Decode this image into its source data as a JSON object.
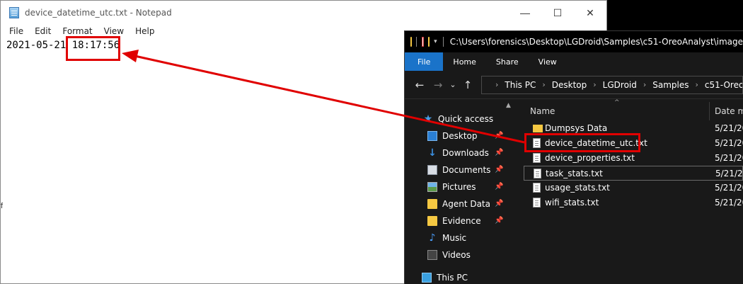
{
  "notepad": {
    "title": "device_datetime_utc.txt - Notepad",
    "controls": {
      "minimize": "—",
      "maximize": "☐",
      "close": "✕"
    },
    "menu": [
      "File",
      "Edit",
      "Format",
      "View",
      "Help"
    ],
    "content_date": "2021-05-21 ",
    "content_time": "18:17:56",
    "left_glyph": "f"
  },
  "explorer": {
    "title_path": "C:\\Users\\forensics\\Desktop\\LGDroid\\Samples\\c51-OreoAnalyst\\image",
    "ribbon": {
      "file": "File",
      "tabs": [
        "Home",
        "Share",
        "View"
      ]
    },
    "nav_buttons": {
      "back": "←",
      "forward": "→",
      "recent": "⌄",
      "up": "↑"
    },
    "breadcrumb": [
      "This PC",
      "Desktop",
      "LGDroid",
      "Samples",
      "c51-OreoAnaly"
    ],
    "nav_pane": {
      "items": [
        {
          "label": "Quick access",
          "icon": "star-icon"
        },
        {
          "label": "Desktop",
          "icon": "desktop-icon"
        },
        {
          "label": "Downloads",
          "icon": "download-icon"
        },
        {
          "label": "Documents",
          "icon": "documents-icon"
        },
        {
          "label": "Pictures",
          "icon": "pictures-icon"
        },
        {
          "label": "Agent Data",
          "icon": "folder-icon"
        },
        {
          "label": "Evidence",
          "icon": "folder-icon"
        },
        {
          "label": "Music",
          "icon": "music-icon"
        },
        {
          "label": "Videos",
          "icon": "videos-icon"
        },
        {
          "label": "This PC",
          "icon": "computer-icon"
        }
      ]
    },
    "columns": {
      "name": "Name",
      "date": "Date mo"
    },
    "files": [
      {
        "name": "Dumpsys Data",
        "date": "5/21/20",
        "type": "folder"
      },
      {
        "name": "device_datetime_utc.txt",
        "date": "5/21/20",
        "type": "txt"
      },
      {
        "name": "device_properties.txt",
        "date": "5/21/20",
        "type": "txt"
      },
      {
        "name": "task_stats.txt",
        "date": "5/21/20",
        "type": "txt"
      },
      {
        "name": "usage_stats.txt",
        "date": "5/21/20",
        "type": "txt"
      },
      {
        "name": "wifi_stats.txt",
        "date": "5/21/20",
        "type": "txt"
      }
    ]
  },
  "colors": {
    "annotation_red": "#e00000",
    "file_tab_blue": "#1a73c9"
  }
}
